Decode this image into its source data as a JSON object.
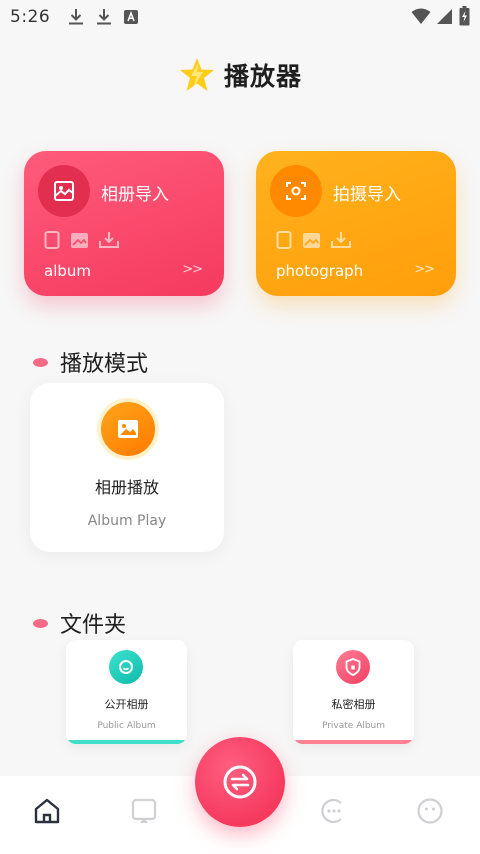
{
  "status_bar": {
    "time": "5:26",
    "left_icons": [
      "download-icon",
      "download-icon",
      "a-notification-icon"
    ],
    "right_icons": [
      "wifi-icon",
      "signal-icon",
      "battery-charging-icon"
    ]
  },
  "header": {
    "title": "播放器",
    "logo_icon": "lightning-star-icon"
  },
  "import_cards": [
    {
      "title": "相册导入",
      "subtitle": "album",
      "arrow": ">>",
      "icon": "image-frame-icon",
      "color": "#f53a5e"
    },
    {
      "title": "拍摄导入",
      "subtitle": "photograph",
      "arrow": ">>",
      "icon": "camera-scan-icon",
      "color": "#ff9e0a"
    }
  ],
  "play_mode": {
    "section_title": "播放模式",
    "card": {
      "title": "相册播放",
      "subtitle": "Album Play",
      "icon": "image-icon"
    }
  },
  "folders": {
    "section_title": "文件夹",
    "items": [
      {
        "title": "公开相册",
        "subtitle": "Public Album",
        "icon": "lens-icon",
        "color": "#41dfc9"
      },
      {
        "title": "私密相册",
        "subtitle": "Private Album",
        "icon": "shield-lock-icon",
        "color": "#ff7f93"
      }
    ]
  },
  "bottom_nav": [
    "home-icon",
    "cast-icon",
    "swap-icon",
    "more-icon",
    "face-icon"
  ],
  "colors": {
    "accent_pink": "#f53a5e",
    "accent_orange": "#ff9e0a",
    "accent_teal": "#41dfc9"
  }
}
